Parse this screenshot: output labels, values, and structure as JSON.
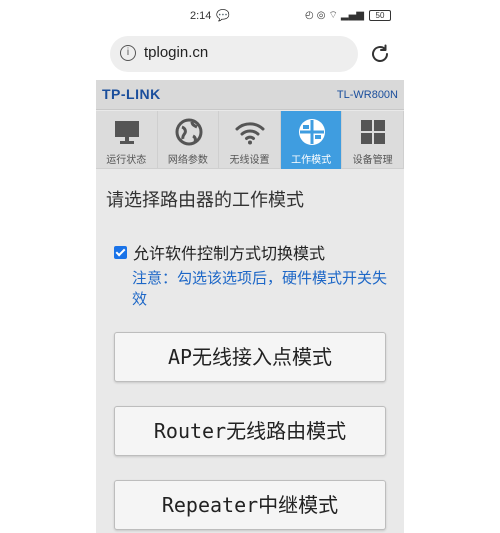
{
  "status_bar": {
    "time": "2:14",
    "battery": "50"
  },
  "url_bar": {
    "url": "tplogin.cn"
  },
  "router": {
    "brand": "TP-LINK",
    "model": "TL-WR800N",
    "tabs": [
      {
        "label": "运行状态",
        "icon": "monitor-icon",
        "active": false
      },
      {
        "label": "网络参数",
        "icon": "globe-icon",
        "active": false
      },
      {
        "label": "无线设置",
        "icon": "wifi-icon",
        "active": false
      },
      {
        "label": "工作模式",
        "icon": "mode-icon",
        "active": true
      },
      {
        "label": "设备管理",
        "icon": "grid-icon",
        "active": false
      }
    ],
    "heading": "请选择路由器的工作模式",
    "checkbox": {
      "label": "允许软件控制方式切换模式",
      "checked": true
    },
    "note": "注意：勾选该选项后，硬件模式开关失效",
    "modes": [
      {
        "label": "AP无线接入点模式"
      },
      {
        "label": "Router无线路由模式"
      },
      {
        "label": "Repeater中继模式"
      }
    ]
  },
  "colors": {
    "brand_blue": "#1a4e9c",
    "active_tab": "#3f9de0",
    "note_blue": "#1d67c7"
  }
}
